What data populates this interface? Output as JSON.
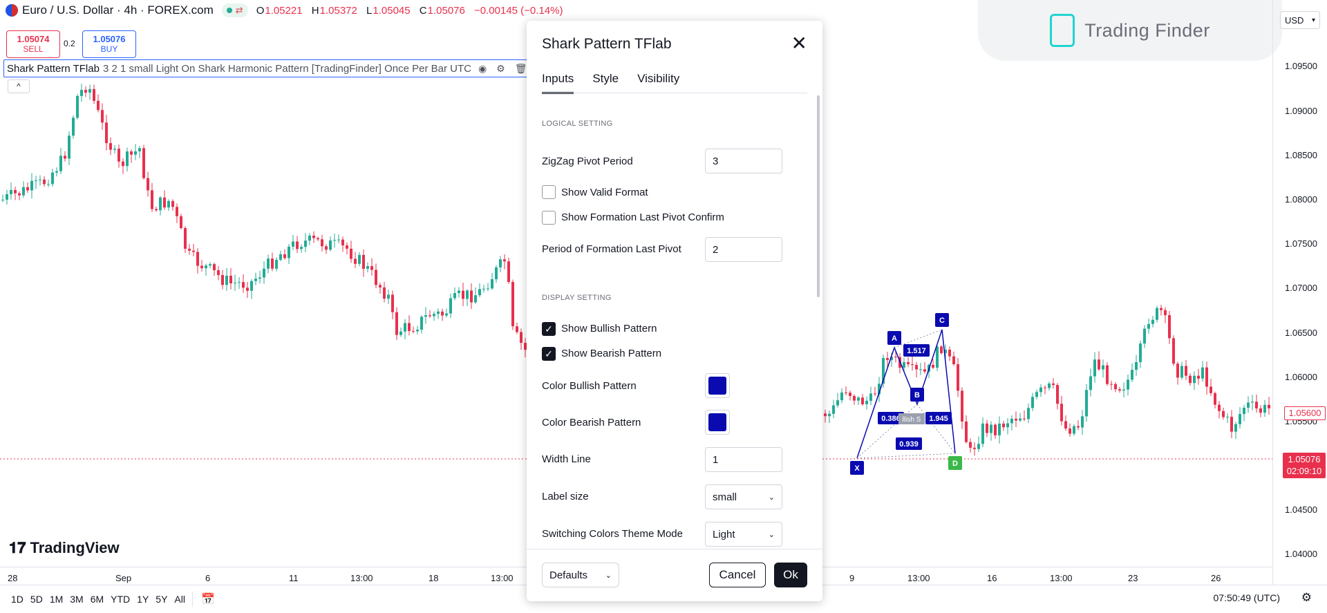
{
  "header": {
    "symbol_title": "Euro / U.S. Dollar · 4h · FOREX.com",
    "ohlc": [
      {
        "k": "O",
        "v": "1.05221"
      },
      {
        "k": "H",
        "v": "1.05372"
      },
      {
        "k": "L",
        "v": "1.05045"
      },
      {
        "k": "C",
        "v": "1.05076"
      }
    ],
    "change": "−0.00145 (−0.14%)"
  },
  "trade": {
    "sell_price": "1.05074",
    "sell_label": "SELL",
    "spread": "0.2",
    "buy_price": "1.05076",
    "buy_label": "BUY"
  },
  "indicator": {
    "name": "Shark Pattern TFlab",
    "args": "3 2 1 small Light On Shark Harmonic Pattern [TradingFinder] Once Per Bar UTC",
    "collapse_icon": "^"
  },
  "currency": "USD",
  "brand": "Trading Finder",
  "price_axis": {
    "labels": [
      "1.09500",
      "1.09000",
      "1.08500",
      "1.08000",
      "1.07500",
      "1.07000",
      "1.06500",
      "1.06000",
      "1.05500",
      "1.04500",
      "1.04000"
    ],
    "tag_level": "1.05600",
    "tag_price": "1.05076",
    "tag_countdown": "02:09:10"
  },
  "time_axis": {
    "labels": [
      "28",
      "Sep",
      "6",
      "11",
      "13:00",
      "18",
      "13:00",
      "9",
      "13:00",
      "16",
      "13:00",
      "23",
      "26"
    ]
  },
  "bottom_bar": {
    "ranges": [
      "1D",
      "5D",
      "1M",
      "3M",
      "6M",
      "YTD",
      "1Y",
      "5Y",
      "All"
    ],
    "clock": "07:50:49 (UTC)"
  },
  "logo_text": "TradingView",
  "pattern": {
    "points": [
      "X",
      "A",
      "B",
      "C",
      "D"
    ],
    "ratios": [
      "1.517",
      "0.386",
      "1.945",
      "0.939"
    ],
    "partial_label": "llish S"
  },
  "colors": {
    "bull": "#22ab94",
    "bear": "#e8304d",
    "pattern": "#0a0ab0",
    "pattern_d": "#3cb84a"
  },
  "dialog": {
    "title": "Shark Pattern TFlab",
    "tabs": [
      "Inputs",
      "Style",
      "Visibility"
    ],
    "sections": {
      "logical": "LOGICAL SETTING",
      "display": "DISPLAY SETTING"
    },
    "zigzag_label": "ZigZag Pivot Period",
    "zigzag_value": "3",
    "show_valid_label": "Show Valid Format",
    "show_valid_checked": false,
    "show_formation_label": "Show Formation Last Pivot Confirm",
    "show_formation_checked": false,
    "period_label": "Period of Formation Last Pivot",
    "period_value": "2",
    "bullish_label": "Show Bullish Pattern",
    "bullish_checked": true,
    "bearish_label": "Show Bearish Pattern",
    "bearish_checked": true,
    "color_bull_label": "Color Bullish Pattern",
    "color_bear_label": "Color Bearish Pattern",
    "width_label": "Width Line",
    "width_value": "1",
    "label_size_label": "Label size",
    "label_size_value": "small",
    "theme_label": "Switching Colors Theme Mode",
    "theme_value": "Light",
    "defaults": "Defaults",
    "cancel": "Cancel",
    "ok": "Ok"
  }
}
